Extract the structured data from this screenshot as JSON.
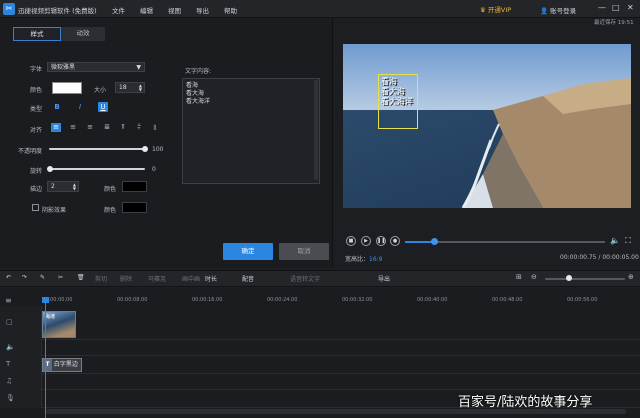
{
  "app": {
    "logo": "✂",
    "title": "迅捷视频剪辑软件 (免费版)",
    "vip": "开通VIP",
    "login": "账号登录",
    "autosave": "最近保存 19:51"
  },
  "menu": [
    "文件",
    "编辑",
    "视图",
    "导出",
    "帮助"
  ],
  "window_buttons": [
    "—",
    "□",
    "✕"
  ],
  "tabs": {
    "style": "样式",
    "anim": "动效"
  },
  "form": {
    "font_label": "字体",
    "font_value": "微软雅黑",
    "color_label": "颜色",
    "size_label": "大小",
    "size_value": "18",
    "type_label": "类型",
    "bold": "B",
    "italic": "I",
    "underline": "U",
    "align_label": "对齐",
    "opacity_label": "不透明度",
    "opacity_value": "100",
    "rotate_label": "旋转",
    "rotate_value": "0",
    "stroke_label": "描边",
    "stroke_value": "2",
    "stroke_color_label": "颜色",
    "shadow_label": "阴影效果",
    "shadow_color_label": "颜色",
    "text_content_label": "文字内容:",
    "text_lines": [
      "看海",
      "看大海",
      "看大海洋"
    ],
    "ok": "确定",
    "cancel": "取消"
  },
  "preview": {
    "overlay_lines": [
      "看海",
      "看大海",
      "看大海洋"
    ],
    "aspect_label": "宽高比：",
    "aspect_value": "16:9",
    "time": "00:00:00.75 / 00:00:05.00",
    "progress": 0.15
  },
  "toolbar": [
    "↶",
    "↷",
    "✎",
    "✂",
    "🗑",
    "剪切",
    "删除",
    "马赛克",
    "画中画",
    "时长",
    "配音",
    "语音转文字",
    "导出"
  ],
  "toolbar_on": [
    0,
    1,
    2,
    3,
    4,
    9,
    10,
    12
  ],
  "ruler": [
    "00:00:00.00",
    "00:00:08.00",
    "00:00:16.00",
    "00:00:24.00",
    "00:00:32.00",
    "00:00:40.00",
    "00:00:48.00",
    "00:00:56.00",
    "00:01:04.00"
  ],
  "clips": {
    "video_name": "海滩",
    "text_name": "白字黑边"
  },
  "watermark": "百家号/陆欢的故事分享"
}
